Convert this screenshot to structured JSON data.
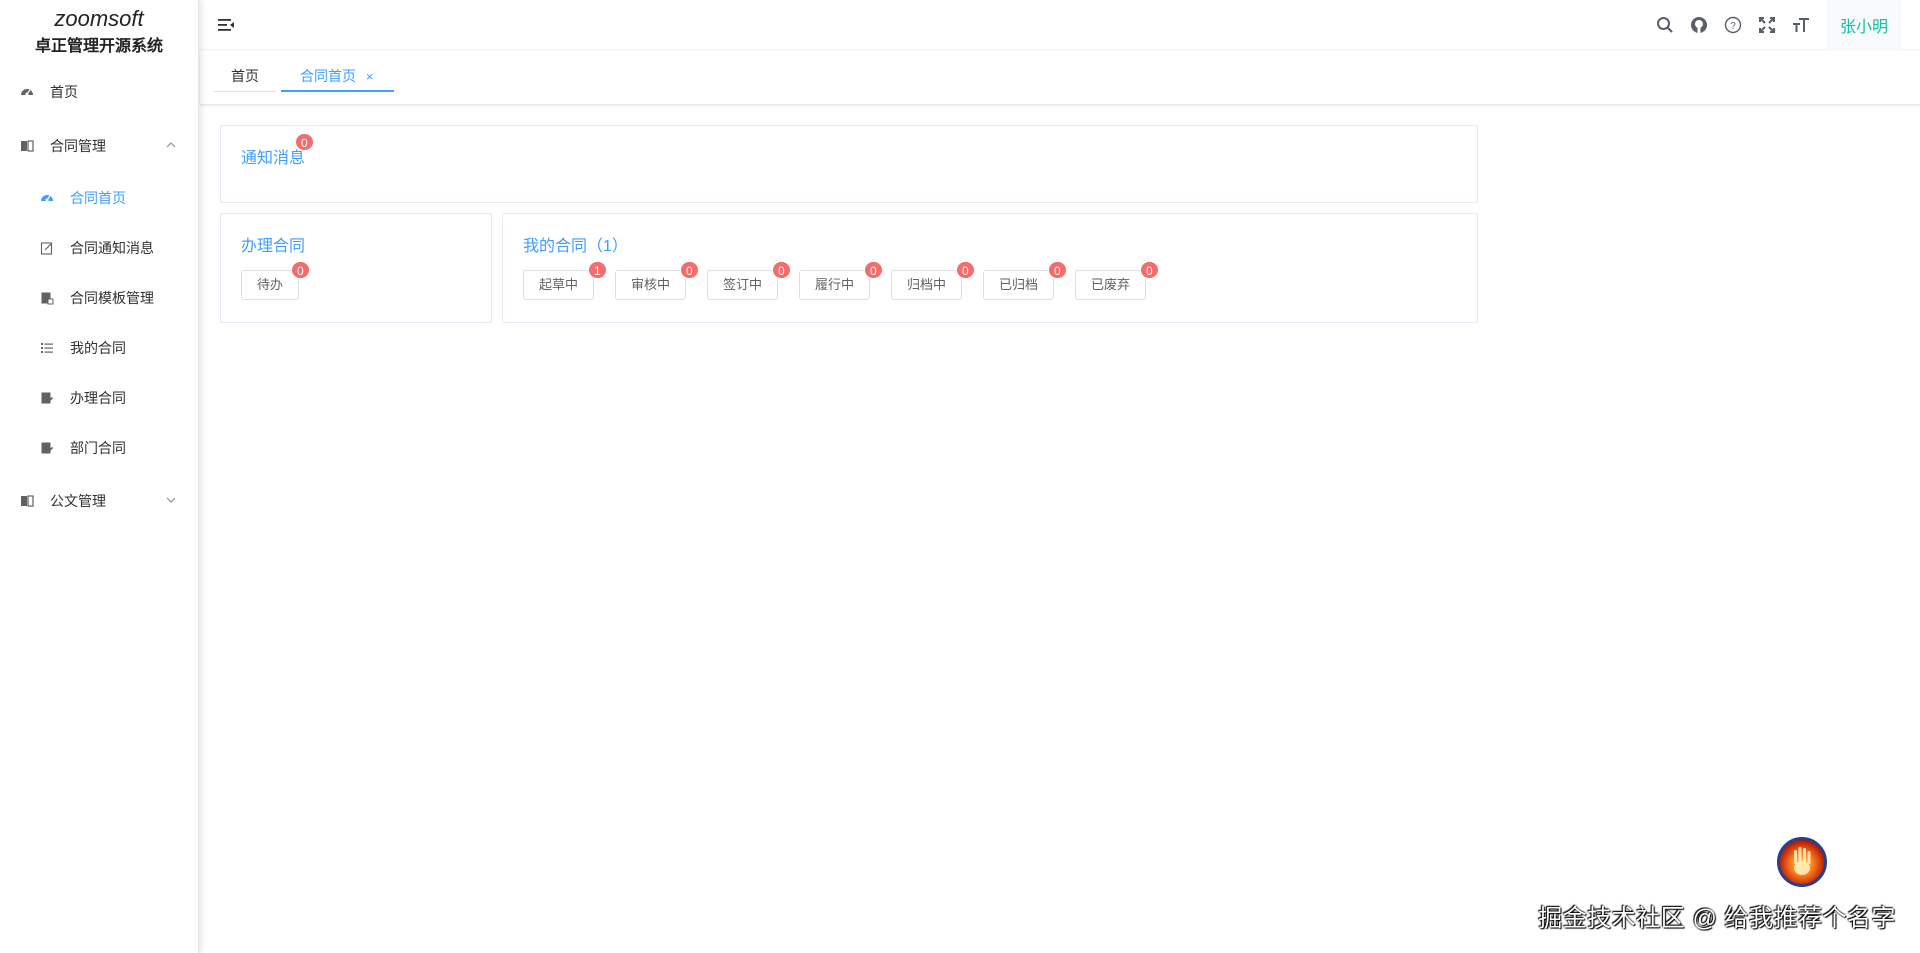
{
  "brand": {
    "logo_text": "zoomsoft",
    "system_name": "卓正管理开源系统"
  },
  "sidebar": {
    "items": [
      {
        "label": "首页",
        "icon": "dashboard-icon"
      },
      {
        "label": "合同管理",
        "icon": "book-icon",
        "expanded": true,
        "children": [
          {
            "label": "合同首页",
            "icon": "dashboard-icon",
            "active": true
          },
          {
            "label": "合同通知消息",
            "icon": "edit-icon"
          },
          {
            "label": "合同模板管理",
            "icon": "template-icon"
          },
          {
            "label": "我的合同",
            "icon": "list-icon"
          },
          {
            "label": "办理合同",
            "icon": "document-edit-icon"
          },
          {
            "label": "部门合同",
            "icon": "document-edit-icon"
          }
        ]
      },
      {
        "label": "公文管理",
        "icon": "book-icon",
        "expanded": false
      }
    ]
  },
  "header": {
    "icons": [
      "search-icon",
      "github-icon",
      "help-icon",
      "fullscreen-icon",
      "font-size-icon"
    ],
    "user_name": "张小明"
  },
  "tabs": [
    {
      "label": "首页",
      "active": false
    },
    {
      "label": "合同首页",
      "active": true,
      "close": "×"
    }
  ],
  "notice_card": {
    "title": "通知消息",
    "count": "0"
  },
  "handle_card": {
    "title": "办理合同",
    "buttons": [
      {
        "label": "待办",
        "count": "0"
      }
    ]
  },
  "my_contract_card": {
    "title": "我的合同（1）",
    "buttons": [
      {
        "label": "起草中",
        "count": "1"
      },
      {
        "label": "审核中",
        "count": "0"
      },
      {
        "label": "签订中",
        "count": "0"
      },
      {
        "label": "履行中",
        "count": "0"
      },
      {
        "label": "归档中",
        "count": "0"
      },
      {
        "label": "已归档",
        "count": "0"
      },
      {
        "label": "已废弃",
        "count": "0"
      }
    ]
  },
  "watermark": "掘金技术社区 @ 给我推荐个名字",
  "colors": {
    "accent": "#409eff",
    "badge": "#f56c6c",
    "user": "#13c2a4"
  }
}
